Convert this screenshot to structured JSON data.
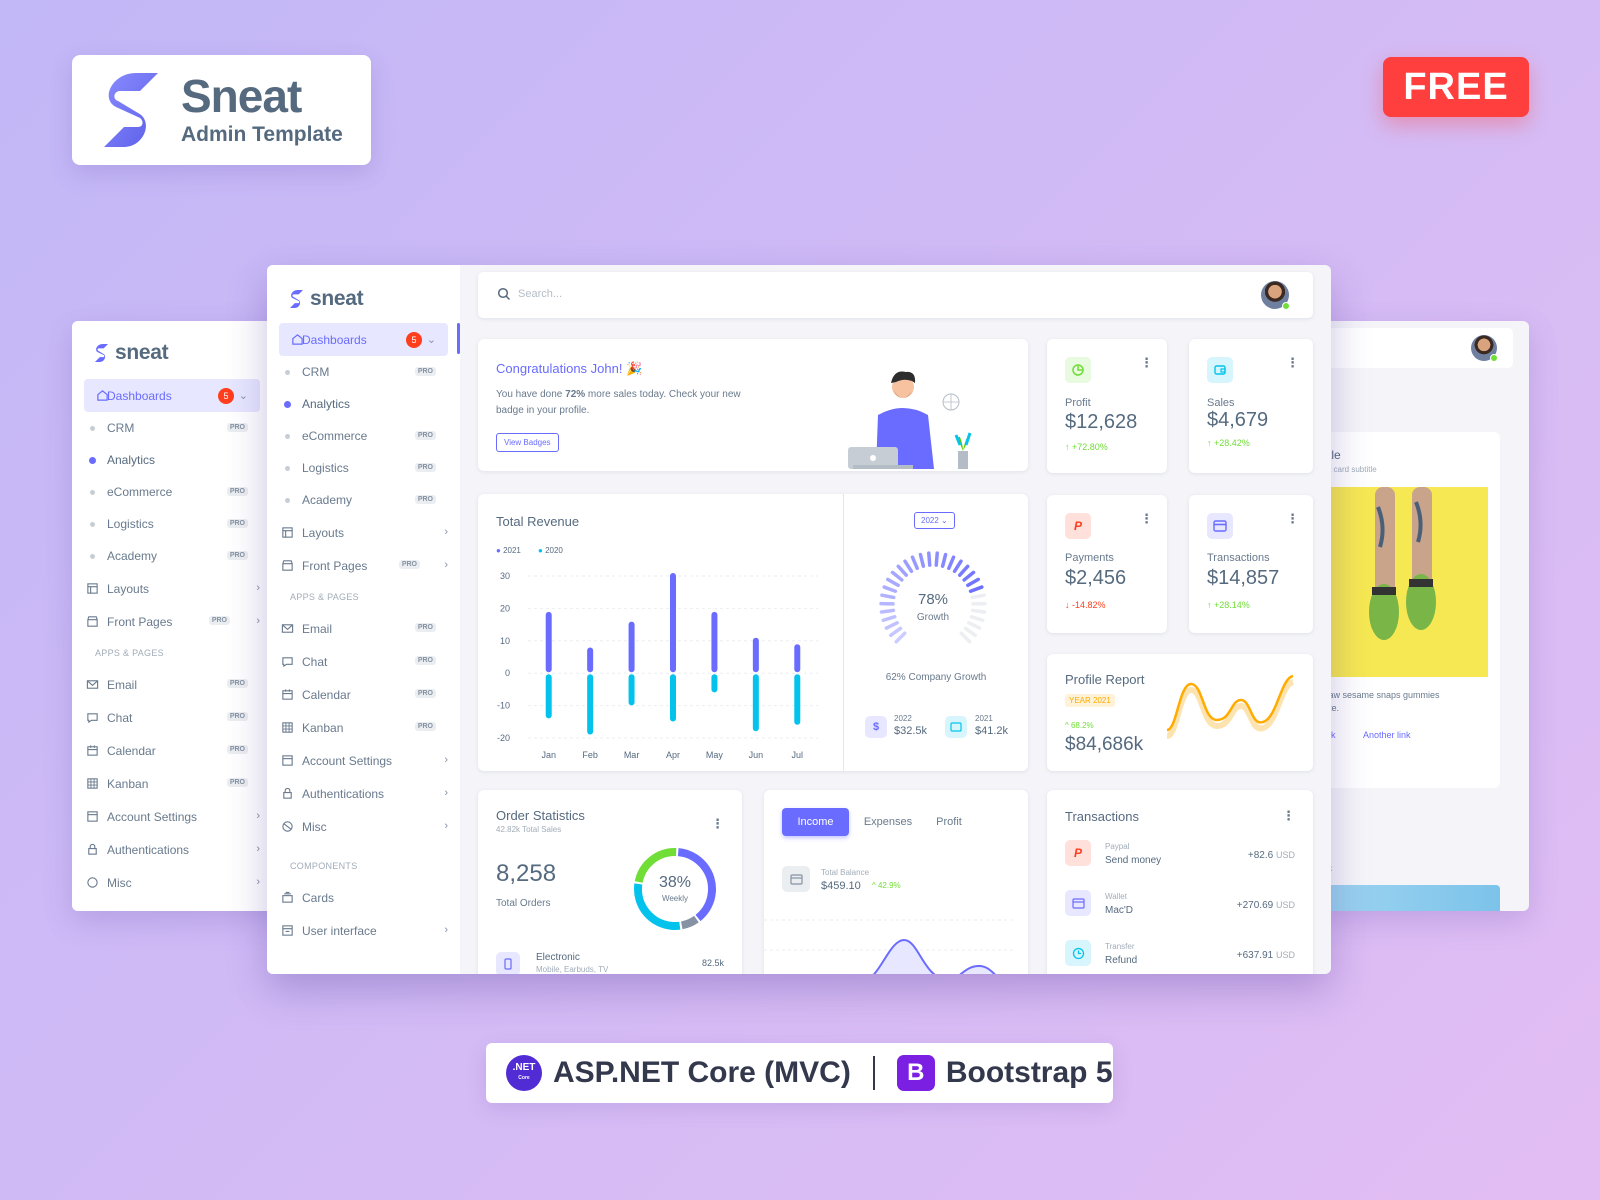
{
  "brand": {
    "logo_name": "Sneat",
    "logo_sub": "Admin Template",
    "free_badge": "FREE",
    "app_name": "sneat"
  },
  "tech": {
    "net_line1": ".NET",
    "net_line2": "Core",
    "aspnet": "ASP.NET Core (MVC)",
    "bs_letter": "B",
    "bootstrap": "Bootstrap 5"
  },
  "sidebar": {
    "dashboards": "Dashboards",
    "badge_count": "5",
    "subs": [
      {
        "label": "CRM",
        "pro": "PRO"
      },
      {
        "label": "Analytics"
      },
      {
        "label": "eCommerce",
        "pro": "PRO"
      },
      {
        "label": "Logistics",
        "pro": "PRO"
      },
      {
        "label": "Academy",
        "pro": "PRO"
      }
    ],
    "layouts": "Layouts",
    "front_pages": "Front Pages",
    "pro": "PRO",
    "apps_header": "APPS & PAGES",
    "apps": [
      {
        "label": "Email",
        "pro": "PRO"
      },
      {
        "label": "Chat",
        "pro": "PRO"
      },
      {
        "label": "Calendar",
        "pro": "PRO"
      },
      {
        "label": "Kanban",
        "pro": "PRO"
      }
    ],
    "account_settings": "Account Settings",
    "authentications": "Authentications",
    "misc": "Misc",
    "components_header": "COMPONENTS",
    "cards": "Cards",
    "user_interface": "User interface"
  },
  "search": {
    "placeholder": "Search..."
  },
  "congrats": {
    "title": "Congratulations John! 🎉",
    "text1": "You have done ",
    "bold": "72%",
    "text2": " more sales today. Check your new",
    "text3": "badge in your profile.",
    "button": "View Badges"
  },
  "stats": [
    {
      "label": "Profit",
      "value": "$12,628",
      "delta": "+72.80%",
      "dir": "up",
      "icon": "chart-pie-icon",
      "color": "#71dd37"
    },
    {
      "label": "Sales",
      "value": "$4,679",
      "delta": "+28.42%",
      "dir": "up",
      "icon": "wallet-icon",
      "color": "#03c3ec"
    },
    {
      "label": "Payments",
      "value": "$2,456",
      "delta": "-14.82%",
      "dir": "down",
      "icon": "paypal-icon",
      "color": "#ff3e1d"
    },
    {
      "label": "Transactions",
      "value": "$14,857",
      "delta": "+28.14%",
      "dir": "up",
      "icon": "credit-card-icon",
      "color": "#696cff"
    }
  ],
  "revenue": {
    "title": "Total Revenue",
    "legend": [
      "2021",
      "2020"
    ]
  },
  "chart_data": {
    "type": "bar",
    "categories": [
      "Jan",
      "Feb",
      "Mar",
      "Apr",
      "May",
      "Jun",
      "Jul"
    ],
    "series": [
      {
        "name": "2021",
        "values": [
          18,
          7,
          15,
          30,
          18,
          10,
          8
        ],
        "color": "#696cff"
      },
      {
        "name": "2020",
        "values": [
          -13,
          -18,
          -9,
          -14,
          -5,
          -17,
          -15
        ],
        "color": "#03c3ec"
      }
    ],
    "ylim": [
      -20,
      30
    ],
    "yticks": [
      30,
      20,
      10,
      0,
      -10,
      -20
    ]
  },
  "growth": {
    "year": "2022",
    "percent": "78%",
    "label": "Growth",
    "company": "62% Company Growth",
    "y1": "2022",
    "v1": "$32.5k",
    "y2": "2021",
    "v2": "$41.2k",
    "value": 78
  },
  "profile_report": {
    "title": "Profile Report",
    "badge": "YEAR 2021",
    "delta": "68.2%",
    "value": "$84,686k"
  },
  "orders": {
    "title": "Order Statistics",
    "subtitle": "42.82k Total Sales",
    "total": "8,258",
    "total_label": "Total Orders",
    "pct": "38%",
    "pct_label": "Weekly",
    "item": "Electronic",
    "item_sub": "Mobile, Earbuds, TV",
    "item_val": "82.5k"
  },
  "income": {
    "tabs": [
      "Income",
      "Expenses",
      "Profit"
    ],
    "balance_label": "Total Balance",
    "balance": "$459.10",
    "delta": "42.9%"
  },
  "transactions": {
    "title": "Transactions",
    "items": [
      {
        "source": "Paypal",
        "name": "Send money",
        "amount": "+82.6",
        "cur": "USD",
        "color": "#ff3e1d",
        "bg": "#ffe0db"
      },
      {
        "source": "Wallet",
        "name": "Mac'D",
        "amount": "+270.69",
        "cur": "USD",
        "color": "#696cff",
        "bg": "#e7e7ff"
      },
      {
        "source": "Transfer",
        "name": "Refund",
        "amount": "+637.91",
        "cur": "USD",
        "color": "#03c3ec",
        "bg": "#d7f5fc"
      }
    ]
  },
  "back_right": {
    "title": "title",
    "subtitle": "ort card subtitle",
    "text1": "claw sesame snaps gummies",
    "text2": "late.",
    "link1": "link",
    "link2": "Another link",
    "link3": "ink"
  }
}
